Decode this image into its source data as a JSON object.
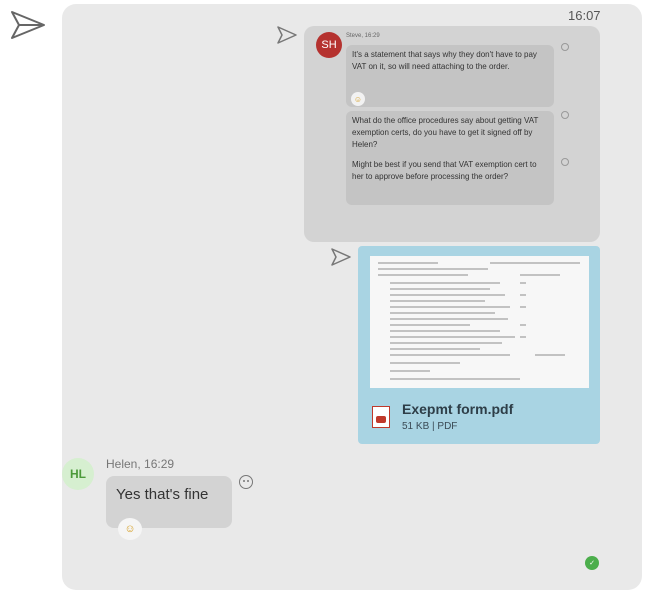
{
  "header": {
    "time": "16:07"
  },
  "steve_group": {
    "avatar_initials": "SH",
    "sender_line": "Steve, 16:29",
    "messages": [
      {
        "text": "It's a statement that says why they don't have to pay VAT on it, so will need attaching to the order."
      },
      {
        "text": "What do the office procedures say about getting VAT exemption certs, do you have to get it signed off by Helen?"
      },
      {
        "text": "Might be best if you send that VAT exemption cert to her to approve before processing the order?"
      }
    ]
  },
  "attachment": {
    "file_name": "Exepmt form.pdf",
    "file_meta": "51 KB | PDF"
  },
  "helen": {
    "avatar_initials": "HL",
    "sender_line": "Helen, 16:29",
    "message": "Yes that's fine"
  },
  "status": {
    "indicator": "✓"
  },
  "icons": {
    "send": "send-icon",
    "pdf": "pdf-file-icon",
    "reaction": "reaction-smiley-icon"
  },
  "colors": {
    "panel": "#e9e9e9",
    "file_card": "#a9d4e3",
    "avatar_steve": "#b5322f",
    "avatar_helen": "#d6efd0",
    "online": "#4cae4c"
  }
}
